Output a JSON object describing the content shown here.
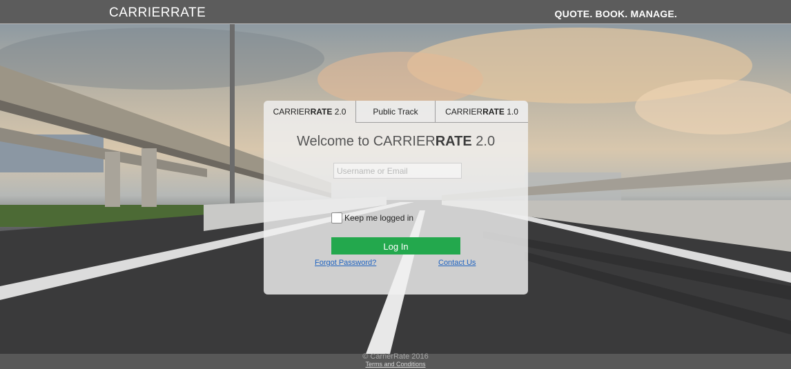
{
  "header": {
    "logo": "CARRIERRATE",
    "tagline": "QUOTE. BOOK. MANAGE."
  },
  "tabs": [
    {
      "prefix": "CARRIER",
      "bold": "RATE",
      "suffix": " 2.0",
      "active": true
    },
    {
      "label": "Public Track"
    },
    {
      "prefix": "CARRIER",
      "bold": "RATE",
      "suffix": " 1.0"
    }
  ],
  "login": {
    "welcome_prefix": "Welcome to CARRIER",
    "welcome_bold": "RATE",
    "welcome_suffix": " 2.0",
    "username_placeholder": "Username or Email",
    "username_value": "",
    "keep_logged_in": "Keep me logged in",
    "keep_checked": false,
    "login_button": "Log In",
    "forgot_password": "Forgot Password?",
    "contact_us": "Contact Us"
  },
  "footer": {
    "copyright": "© CarrierRate 2016",
    "terms": "Terms and Conditions"
  },
  "colors": {
    "header_bg": "#5c5c5c",
    "login_button": "#23a84d",
    "link": "#1f63c0"
  }
}
